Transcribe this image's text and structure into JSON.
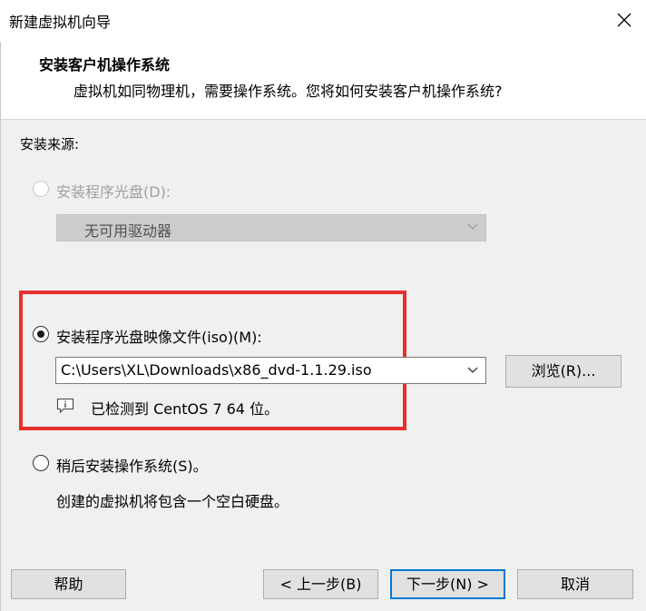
{
  "window": {
    "title": "新建虚拟机向导"
  },
  "header": {
    "title": "安装客户机操作系统",
    "description": "虚拟机如同物理机，需要操作系统。您将如何安装客户机操作系统?"
  },
  "install_source": {
    "label": "安装来源:",
    "disc_option": {
      "label": "安装程序光盘(D):",
      "selected": false,
      "enabled": false,
      "drive_value": "无可用驱动器"
    },
    "iso_option": {
      "label": "安装程序光盘映像文件(iso)(M):",
      "selected": true,
      "path_value": "C:\\Users\\XL\\Downloads\\x86_dvd-1.1.29.iso",
      "browse_label": "浏览(R)...",
      "detected_text": "已检测到 CentOS 7 64 位。"
    },
    "later_option": {
      "label": "稍后安装操作系统(S)。",
      "selected": false,
      "description": "创建的虚拟机将包含一个空白硬盘。"
    }
  },
  "buttons": {
    "help": "帮助",
    "back": "< 上一步(B)",
    "next": "下一步(N) >",
    "cancel": "取消"
  },
  "colors": {
    "highlight_border": "#e8302e",
    "primary_button_border": "#0078d7"
  },
  "icons": {
    "close": "close-icon",
    "dropdown": "chevron-down-icon",
    "info": "info-icon"
  }
}
